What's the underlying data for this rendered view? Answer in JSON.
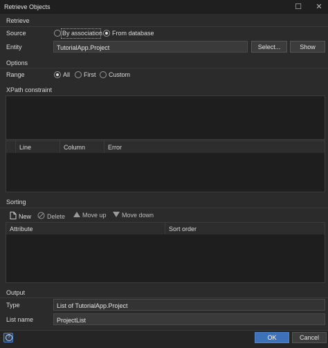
{
  "window": {
    "title": "Retrieve Objects"
  },
  "retrieve": {
    "section_label": "Retrieve",
    "source_label": "Source",
    "source_options": [
      "By association",
      "From database"
    ],
    "source_selected": "From database",
    "entity_label": "Entity",
    "entity_value": "TutorialApp.Project",
    "select_button": "Select...",
    "show_button": "Show"
  },
  "options": {
    "section_label": "Options",
    "range_label": "Range",
    "range_options": [
      "All",
      "First",
      "Custom"
    ],
    "range_selected": "All",
    "xpath_label": "XPath constraint",
    "xpath_value": "",
    "error_columns": [
      "Line",
      "Column",
      "Error"
    ]
  },
  "sorting": {
    "section_label": "Sorting",
    "toolbar": {
      "new": "New",
      "delete": "Delete",
      "move_up": "Move up",
      "move_down": "Move down"
    },
    "columns": [
      "Attribute",
      "Sort order"
    ]
  },
  "output": {
    "section_label": "Output",
    "type_label": "Type",
    "type_value": "List of TutorialApp.Project",
    "listname_label": "List name",
    "listname_value": "ProjectList"
  },
  "footer": {
    "help_icon": "?",
    "ok": "OK",
    "cancel": "Cancel"
  }
}
